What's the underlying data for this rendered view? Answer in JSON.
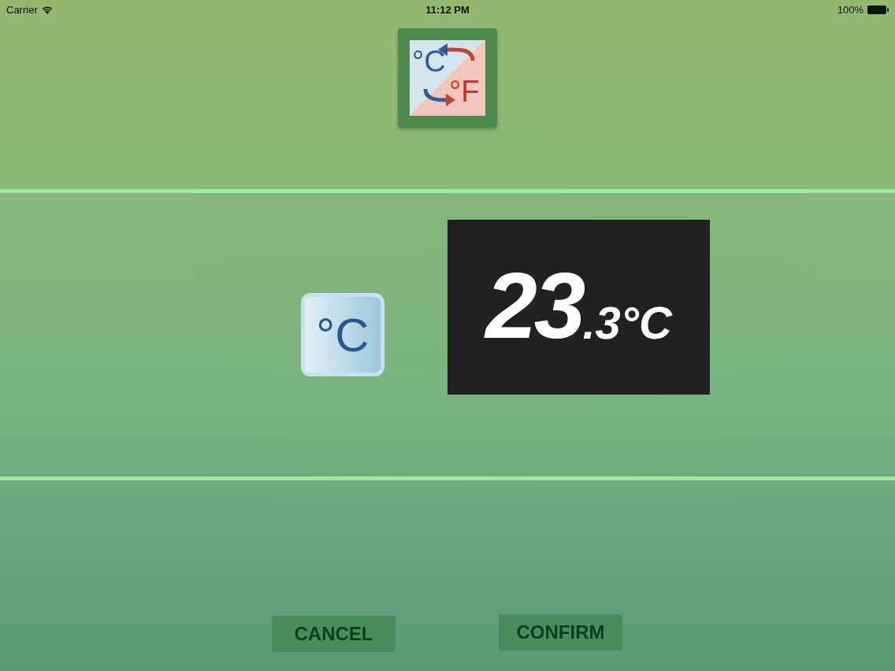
{
  "status_bar": {
    "carrier": "Carrier",
    "time": "11:12 PM",
    "battery": "100%"
  },
  "mode_icon": {
    "from_unit": "°C",
    "to_unit": "°F"
  },
  "unit_button": {
    "label": "°C"
  },
  "display": {
    "integer": "23",
    "fraction": ".3°C"
  },
  "buttons": [
    {
      "label": "CANCEL"
    },
    {
      "label": "CONFIRM"
    }
  ]
}
